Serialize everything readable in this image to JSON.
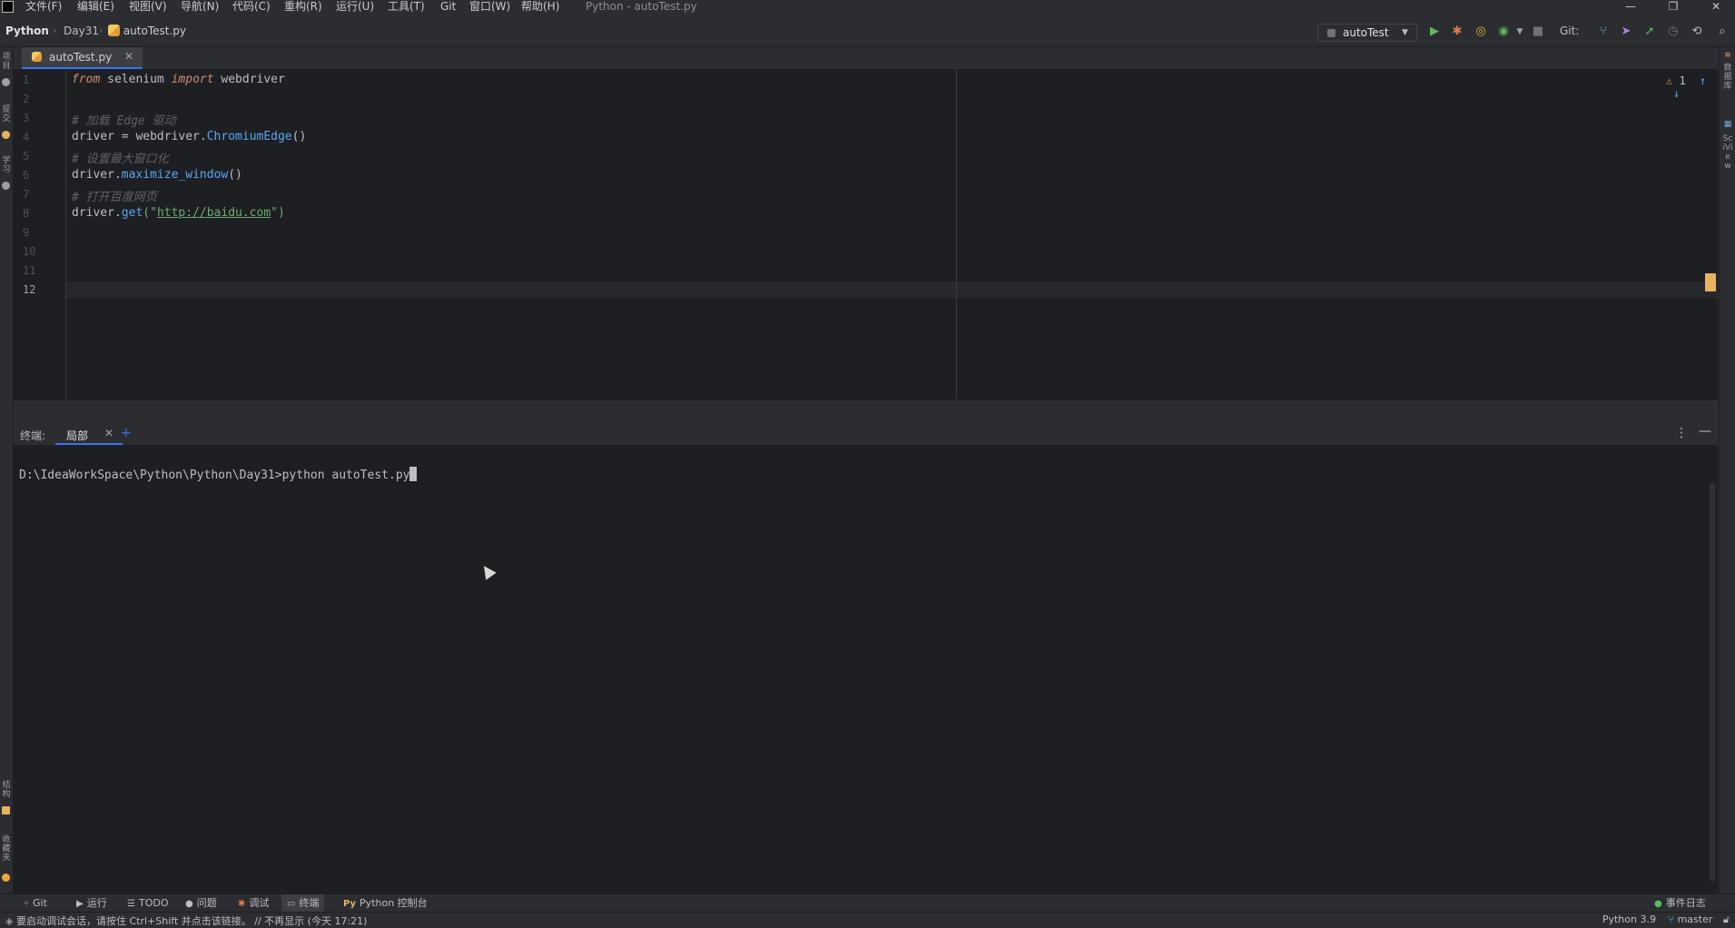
{
  "menubar": {
    "items": [
      "文件(F)",
      "编辑(E)",
      "视图(V)",
      "导航(N)",
      "代码(C)",
      "重构(R)",
      "运行(U)",
      "工具(T)",
      "Git",
      "窗口(W)",
      "帮助(H)"
    ],
    "window_title": "Python - autoTest.py",
    "minimize": "—",
    "restore": "❐",
    "close": "✕"
  },
  "navbar": {
    "breadcrumbs": [
      "Python",
      "Day31",
      "autoTest.py"
    ],
    "run_config": "autoTest",
    "git_label": "Git:"
  },
  "left_strip": {
    "labels": [
      "项目",
      "提交",
      "学习",
      "结构",
      "收藏夹"
    ]
  },
  "right_strip": {
    "labels": [
      "数据库",
      "SciView"
    ]
  },
  "editor": {
    "tab_label": "autoTest.py",
    "line_numbers": [
      "1",
      "2",
      "3",
      "4",
      "5",
      "6",
      "7",
      "8",
      "9",
      "10",
      "11",
      "12"
    ],
    "lines": [
      {
        "kw1": "from",
        "t1": " selenium ",
        "kw2": "import",
        "t2": " webdriver"
      },
      {},
      {
        "comment": "# 加载 Edge 驱动"
      },
      {
        "t1": "driver = webdriver.",
        "fn": "ChromiumEdge",
        "t2": "()"
      },
      {
        "comment": "# 设置最大窗口化"
      },
      {
        "t1": "driver.",
        "fn": "maximize_window",
        "t2": "()"
      },
      {
        "comment": "# 打开百度网页"
      },
      {
        "t1": "driver.",
        "fn": "get",
        "t2": "(\"",
        "url": "http://baidu.com",
        "t3": "\")"
      }
    ],
    "warning_count": "1"
  },
  "terminal": {
    "title": "终端:",
    "tab_label": "局部",
    "add_label": "+",
    "prompt": "D:\\IdeaWorkSpace\\Python\\Python\\Day31>",
    "command": "python autoTest.py"
  },
  "bottom_tools": {
    "git": "Git",
    "run": "运行",
    "todo": "TODO",
    "problems": "问题",
    "debug": "调试",
    "terminal": "终端",
    "python_console": "Python 控制台",
    "event_log": "事件日志"
  },
  "status": {
    "message": "要启动调试会话，请按住 Ctrl+Shift 并点击该链接。 // 不再显示 (今天 17:21)",
    "interpreter": "Python 3.9",
    "branch": "master"
  },
  "colors": {
    "accent": "#3574f0",
    "keyword": "#cf8e6d",
    "function": "#56a8f5",
    "string": "#6aab73",
    "comment": "#5f6268",
    "warning": "#f0a732"
  }
}
